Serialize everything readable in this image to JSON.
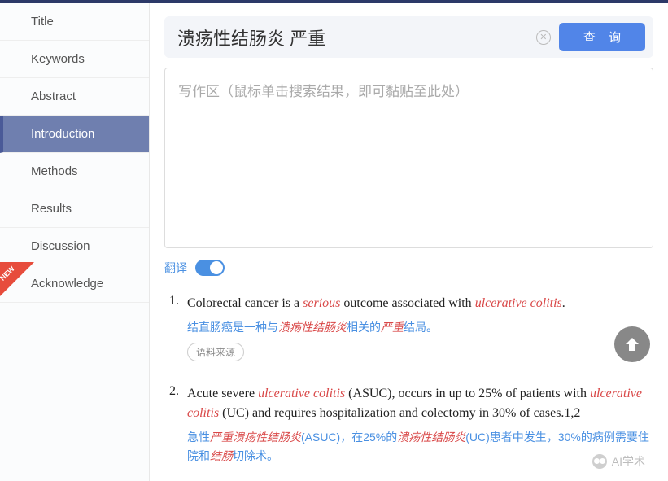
{
  "sidebar": {
    "items": [
      {
        "label": "Title"
      },
      {
        "label": "Keywords"
      },
      {
        "label": "Abstract"
      },
      {
        "label": "Introduction"
      },
      {
        "label": "Methods"
      },
      {
        "label": "Results"
      },
      {
        "label": "Discussion"
      },
      {
        "label": "Acknowledge"
      }
    ],
    "active_index": 3,
    "new_badge": "NEW"
  },
  "search": {
    "value": "溃疡性结肠炎 严重",
    "query_button": "查 询"
  },
  "write_area": {
    "placeholder": "写作区（鼠标单击搜索结果，即可黏贴至此处）"
  },
  "translate": {
    "label": "翻译",
    "enabled": true
  },
  "results": [
    {
      "num": "1.",
      "en_parts": [
        "Colorectal cancer is a ",
        {
          "hl": "serious"
        },
        " outcome associated with ",
        {
          "hl": "ulcerative colitis"
        },
        "."
      ],
      "zh_parts": [
        "结直肠癌是一种与",
        {
          "hl": "溃疡性结肠炎"
        },
        "相关的",
        {
          "hl": "严重"
        },
        "结局。"
      ],
      "source_label": "语料来源"
    },
    {
      "num": "2.",
      "en_parts": [
        "Acute severe ",
        {
          "hl": "ulcerative colitis"
        },
        " (ASUC), occurs in up to 25% of patients with ",
        {
          "hl": "ulcerative colitis"
        },
        " (UC) and requires hospitalization and colectomy in 30% of cases.1,2"
      ],
      "zh_parts": [
        "急性",
        {
          "hl": "严重溃疡性结肠炎"
        },
        "(ASUC)，在25%的",
        {
          "hl": "溃疡性结肠炎"
        },
        "(UC)患者中发生，30%的病例需要住院和",
        {
          "hl": "结肠"
        },
        "切除术。"
      ]
    }
  ],
  "watermark": "AI学术"
}
